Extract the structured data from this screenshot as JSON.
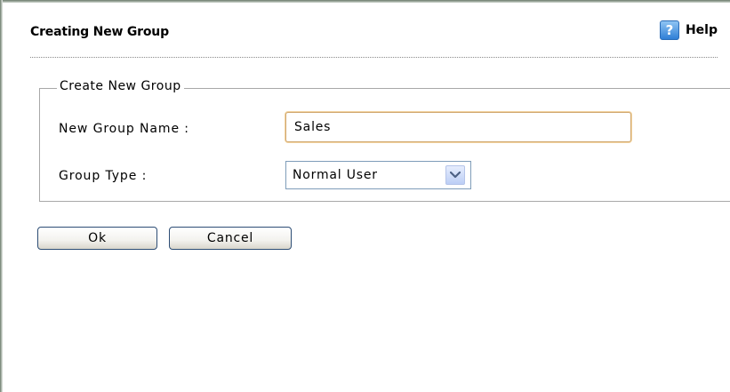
{
  "header": {
    "title": "Creating New Group",
    "help_icon_glyph": "?",
    "help_label": "Help"
  },
  "form": {
    "legend": "Create New Group",
    "group_name_label": "New Group Name :",
    "group_name_value": "Sales",
    "group_type_label": "Group Type :",
    "group_type_selected": "Normal User"
  },
  "buttons": {
    "ok_label": "Ok",
    "cancel_label": "Cancel"
  },
  "icons": {
    "help": "help-icon",
    "dropdown": "chevron-down-icon"
  },
  "colors": {
    "input_focus_border": "#d0a870",
    "select_border": "#7f9db9",
    "button_border": "#2d4d75",
    "help_icon_blue": "#2f7fd6"
  }
}
